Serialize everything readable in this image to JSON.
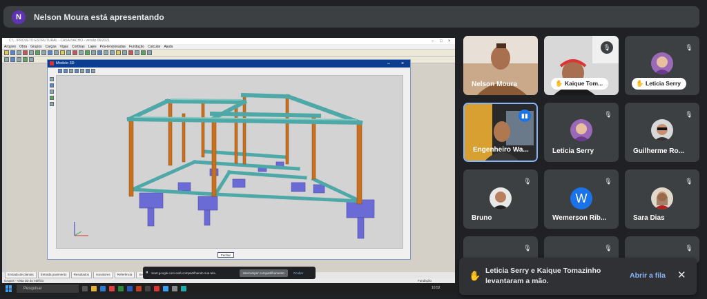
{
  "banner": {
    "avatar_letter": "N",
    "text": "Nelson Moura está apresentando"
  },
  "shared_app": {
    "title": "C:\\...\\PROJETO ESTRUTURAL - CASA BACHO - versão 06/2021",
    "menu": [
      "Arquivo",
      "Obra",
      "Grupos",
      "Cargas",
      "Vigas",
      "Cortinas",
      "Lajes",
      "Pós-tensionadas",
      "Fundação",
      "Calcular",
      "Ajuda"
    ],
    "model_window_title": "Modelo 3D",
    "model_close_label": "Fechar",
    "bottom_tabs": [
      "Entrada de plantas",
      "Entrada pavimento",
      "Resultados",
      "Isovalores",
      "Referência",
      "Seguir"
    ],
    "status_left": "Grupos - Vista 3D do edifício",
    "status_right": "Fundação",
    "taskbar_search": "Pesquisar",
    "taskbar_clock": "10:52"
  },
  "share_bar": {
    "message": "meet.google.com está compartilhando sua tela.",
    "stop_label": "Interromper compartilhamento",
    "hide_label": "Ocultar"
  },
  "participants": [
    {
      "name": "Nelson Moura",
      "muted": false,
      "video": true
    },
    {
      "name": "Kaique Tom...",
      "muted": true,
      "hand_raised": true,
      "video": true
    },
    {
      "name": "Leticia Serry",
      "muted": true,
      "hand_raised": true
    },
    {
      "name": "Engenheiro Wa...",
      "muted": false,
      "speaking": true,
      "video": true
    },
    {
      "name": "Leticia Serry",
      "muted": true
    },
    {
      "name": "Guilherme Ro...",
      "muted": true
    },
    {
      "name": "Bruno",
      "muted": true
    },
    {
      "name": "Wemerson Rib...",
      "muted": true,
      "initial": "W"
    },
    {
      "name": "Sara Dias",
      "muted": true
    }
  ],
  "toast": {
    "message": "Leticia Serry e Kaique Tomazinho levantaram a mão.",
    "action_label": "Abrir a fila"
  },
  "colors": {
    "background": "#202124",
    "tile": "#3c4043",
    "accent": "#8ab4f8",
    "beam": "#4fa8a8",
    "column": "#c8701e",
    "footing": "#6b6bd6"
  }
}
